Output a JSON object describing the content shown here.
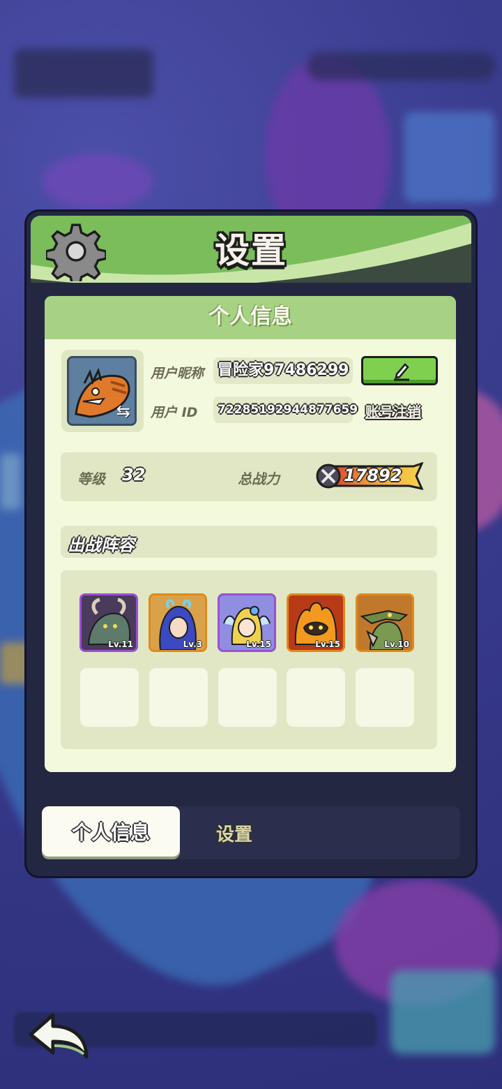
{
  "dialog": {
    "title": "设置"
  },
  "profile_panel": {
    "header": "个人信息",
    "nickname_label": "用户昵称",
    "nickname_value": "冒险家97486299",
    "user_id_label": "用户 ID",
    "user_id_value": "72285192944877659",
    "cancel_account_label": "账号注销",
    "level_label": "等级",
    "level_value": "32",
    "power_label": "总战力",
    "power_value": "17892",
    "lineup_title": "出战阵容",
    "heroes": [
      {
        "level": "Lv.11",
        "frame_color": "#9b4fd6"
      },
      {
        "level": "Lv.3",
        "frame_color": "#e08a1c"
      },
      {
        "level": "Lv.15",
        "frame_color": "#9b4fd6"
      },
      {
        "level": "Lv.15",
        "frame_color": "#e08a1c"
      },
      {
        "level": "Lv.10",
        "frame_color": "#e08a1c"
      }
    ]
  },
  "tabs": [
    {
      "label": "个人信息",
      "active": true
    },
    {
      "label": "设置",
      "active": false
    }
  ],
  "icons": [
    "gear-icon",
    "pencil-icon",
    "swap-icon",
    "sword-icon",
    "back-arrow-icon"
  ],
  "colors": {
    "accent_green": "#7bbd5a",
    "panel_bg": "#f3f9dd",
    "dialog_bg": "#232742"
  }
}
